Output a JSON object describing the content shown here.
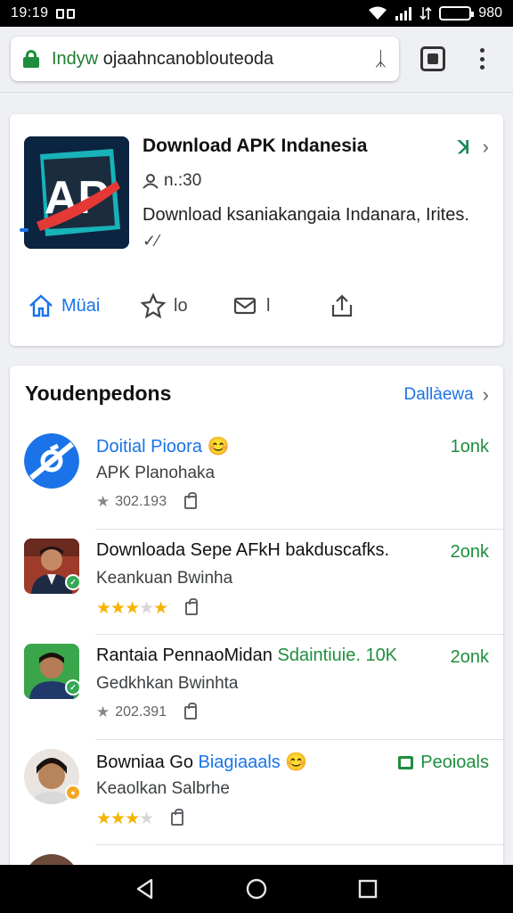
{
  "status_bar": {
    "time": "19:19",
    "battery": "980"
  },
  "browser": {
    "url_scheme": "Indyw",
    "url_rest": " ojaahncanoblouteoda",
    "clear_label": "ᛣ"
  },
  "app_card": {
    "title": "Download APK Indanesia",
    "author": "n.:30",
    "description": "Download ksaniakangaia Indanara, Irites.",
    "icon_text": "AP",
    "actions": [
      {
        "name": "home",
        "label": "Müai"
      },
      {
        "name": "star",
        "label": "lo"
      },
      {
        "name": "mail",
        "label": "l"
      },
      {
        "name": "share",
        "label": ""
      }
    ]
  },
  "recommendations": {
    "heading": "Youdenpedons",
    "link_label": "Dallàewa",
    "items": [
      {
        "title_prefix": "",
        "title_highlight": "Doitial Pioora",
        "title_suffix": " 😊",
        "subtitle": "APK Planohaka",
        "stats": "302.193",
        "rating": null,
        "size": "1onk",
        "size_style": "text"
      },
      {
        "title_prefix": "Downloada Sepe AFkH bakduscafks.",
        "title_highlight": "",
        "title_suffix": "",
        "subtitle": "Keankuan Bwinha",
        "stats": "",
        "rating": 3,
        "size": "2onk",
        "size_style": "text"
      },
      {
        "title_prefix": "Rantaia PennaoMidan ",
        "title_highlight_green": "Sdaintiuie. 10K",
        "title_suffix": "",
        "subtitle": "Gedkhkan Bwinhta",
        "stats": "202.391",
        "rating": null,
        "size": "2onk",
        "size_style": "text"
      },
      {
        "title_prefix": "Bowniaa Go ",
        "title_highlight": "Biagiaaals",
        "title_suffix": " 😊",
        "subtitle": "Keaolkan Salbrhe",
        "stats": "",
        "rating": 3.5,
        "size": "Peoioals",
        "size_style": "box"
      }
    ]
  },
  "colors": {
    "accent": "#1a73e8",
    "green": "#1e8e3e",
    "star": "#f4b400"
  }
}
